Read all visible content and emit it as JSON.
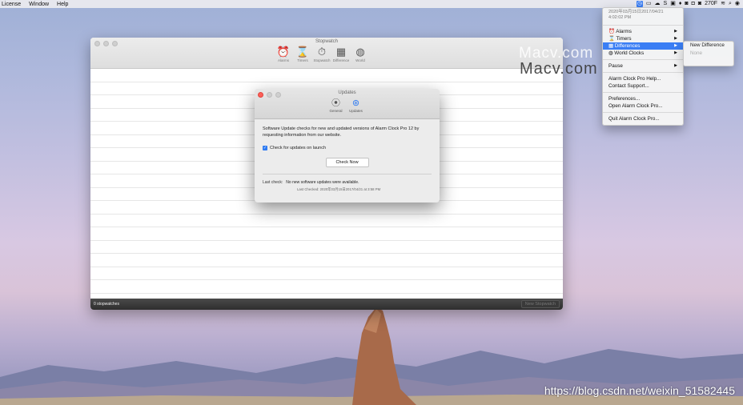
{
  "menubar": {
    "items": [
      "License",
      "Window",
      "Help"
    ],
    "right_icons": [
      "clock-icon",
      "screen-icon",
      "cloud-icon",
      "s-icon",
      "box-icon",
      "leaf-icon",
      "app-icon",
      "app2-icon",
      "app3-icon"
    ],
    "temp": "270F",
    "status": "⇨"
  },
  "stopwatch_window": {
    "title": "Stopwatch",
    "tabs": [
      {
        "icon": "alarm-icon",
        "label": "Alarms"
      },
      {
        "icon": "timer-icon",
        "label": "Timers"
      },
      {
        "icon": "stopwatch-icon",
        "label": "Stopwatch"
      },
      {
        "icon": "difference-icon",
        "label": "Difference"
      },
      {
        "icon": "world-icon",
        "label": "World"
      }
    ],
    "footer_count": "0 stopwatches",
    "new_button": "New Stopwatch"
  },
  "updates_dialog": {
    "title": "Updates",
    "tabs": [
      {
        "icon": "general-icon",
        "label": "General"
      },
      {
        "icon": "updates-icon",
        "label": "Updates"
      }
    ],
    "description": "Software Update checks for new and updated versions of Alarm Clock Pro 12 by requesting information from our website.",
    "checkbox_label": "Check for updates on launch",
    "checkbox_checked": true,
    "check_now": "Check Now",
    "last_check_label": "Last check:",
    "last_check_value": "No new software updates were available.",
    "last_checked_sub": "Last Checked: 2020年03月15日2017/04/21 at 3:58 PM"
  },
  "menu": {
    "header_line1": "2020年03月15日2017/04/21",
    "header_line2": "4:02:02 PM",
    "items": [
      "Alarms",
      "Timers",
      "Differences",
      "World Clocks"
    ],
    "pause": "Pause",
    "help": "Alarm Clock Pro Help...",
    "support": "Contact Support...",
    "prefs": "Preferences...",
    "open": "Open Alarm Clock Pro...",
    "quit": "Quit Alarm Clock Pro..."
  },
  "submenu": {
    "items": [
      "New Difference",
      "None"
    ]
  },
  "watermark": {
    "a": "Macv.com",
    "b": "Macv.com"
  },
  "csdn": "https://blog.csdn.net/weixin_51582445",
  "colors": {
    "accent": "#3b7ef4",
    "close": "#fc5f57"
  }
}
